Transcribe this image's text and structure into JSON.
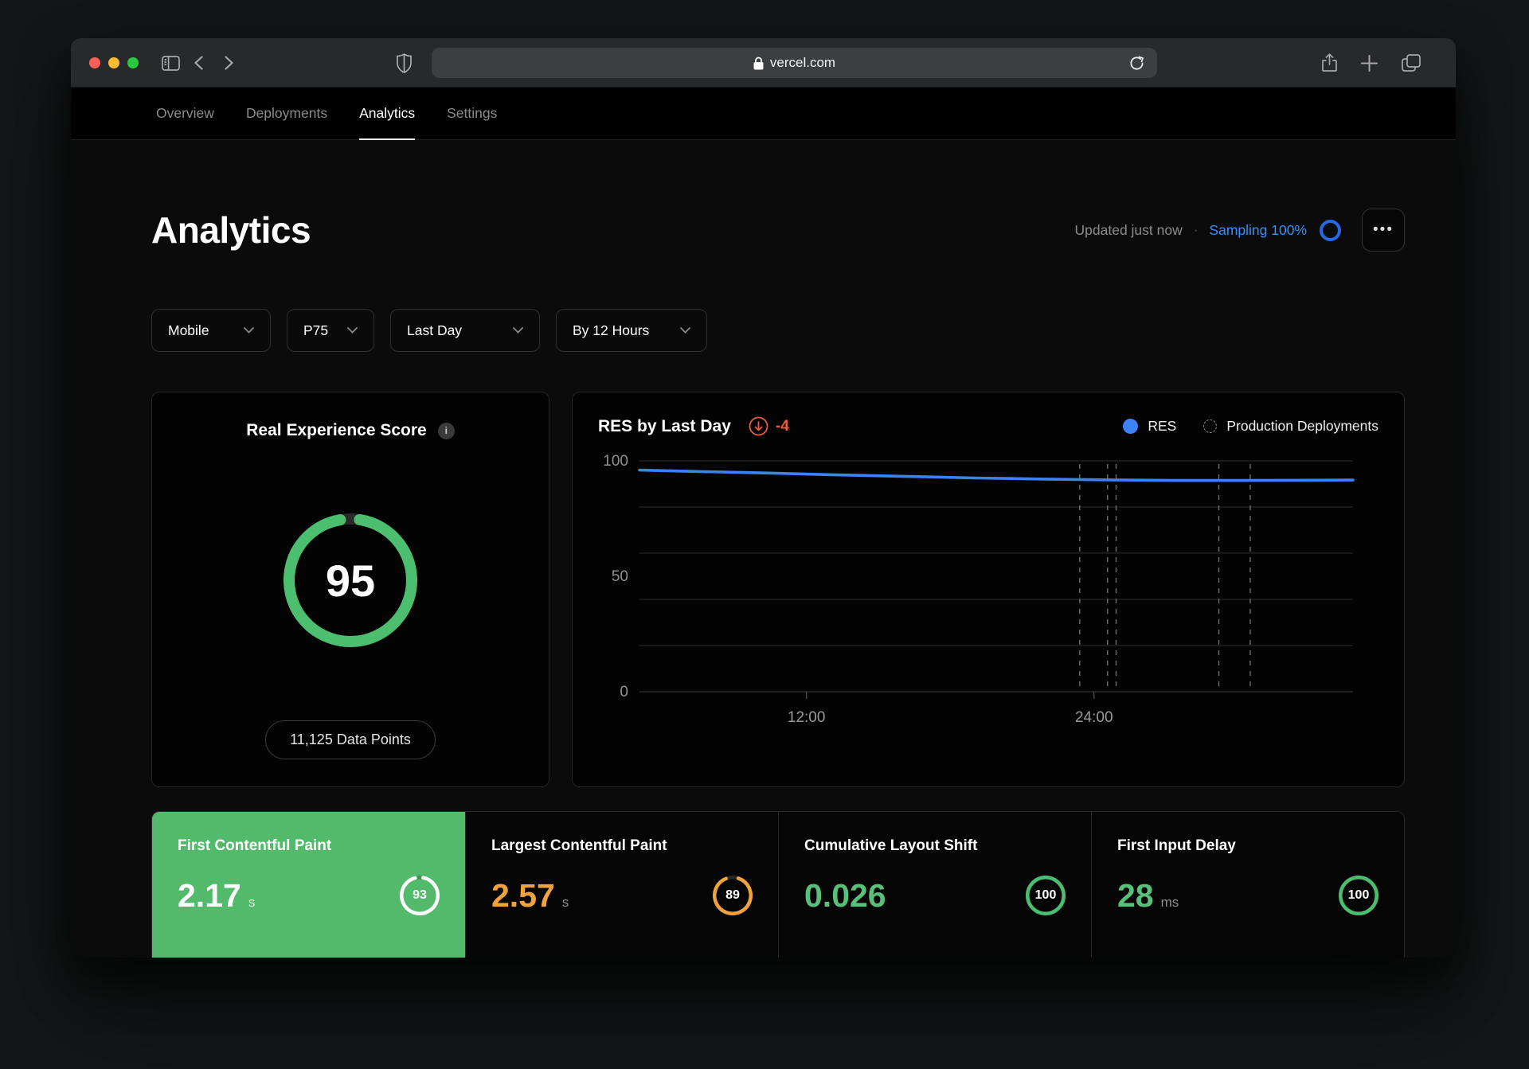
{
  "browser": {
    "url": "vercel.com",
    "traffic_lights": {
      "close": "#ff5f57",
      "minimize": "#febc2e",
      "zoom": "#28c840"
    }
  },
  "nav": {
    "tabs": [
      {
        "label": "Overview",
        "active": false
      },
      {
        "label": "Deployments",
        "active": false
      },
      {
        "label": "Analytics",
        "active": true
      },
      {
        "label": "Settings",
        "active": false
      }
    ]
  },
  "page": {
    "title": "Analytics",
    "updated": "Updated just now",
    "separator": "·",
    "sampling": "Sampling 100%"
  },
  "filters": [
    {
      "label": "Mobile"
    },
    {
      "label": "P75"
    },
    {
      "label": "Last Day"
    },
    {
      "label": "By 12 Hours"
    }
  ],
  "score_card": {
    "title": "Real Experience Score",
    "info_icon": "i",
    "score": 95,
    "max": 100,
    "ring_color": "#4cbe70",
    "data_points": "11,125 Data Points"
  },
  "chart_card": {
    "title": "RES by Last Day",
    "delta": "-4",
    "delta_color": "#ed5a41",
    "legend": [
      {
        "label": "RES",
        "marker": "dot",
        "color": "#3b82f6"
      },
      {
        "label": "Production Deployments",
        "marker": "dashed-circle"
      }
    ]
  },
  "chart_data": {
    "type": "line",
    "title": "RES by Last Day",
    "grid": "horizontal",
    "legend_position": "top-right",
    "y_axis": {
      "min": 0,
      "max": 100,
      "tick_labels": [
        100,
        50,
        0
      ],
      "gridline_step": 20
    },
    "x_ticks": [
      {
        "label": "12:00",
        "pos": 0.234
      },
      {
        "label": "24:00",
        "pos": 0.637
      }
    ],
    "series": [
      {
        "name": "RES",
        "color": "#3b82f6",
        "points": [
          [
            0,
            96
          ],
          [
            0.08,
            95.4
          ],
          [
            0.17,
            94.8
          ],
          [
            0.27,
            94.0
          ],
          [
            0.37,
            93.3
          ],
          [
            0.47,
            92.6
          ],
          [
            0.57,
            92.1
          ],
          [
            0.65,
            91.8
          ],
          [
            0.75,
            91.5
          ],
          [
            0.85,
            91.5
          ],
          [
            1,
            91.7
          ]
        ]
      }
    ],
    "deployment_markers": {
      "name": "Production Deployments",
      "positions": [
        0.617,
        0.656,
        0.668,
        0.812,
        0.856
      ]
    }
  },
  "metrics": [
    {
      "title": "First Contentful Paint",
      "value": "2.17",
      "unit": "s",
      "score": 93,
      "selected": true,
      "bg": "#53ba6b",
      "value_color": "#ffffff",
      "unit_color": "rgba(255,255,255,0.82)",
      "ring_color": "#ffffff",
      "track_color": "rgba(0,0,0,0.22)"
    },
    {
      "title": "Largest Contentful Paint",
      "value": "2.57",
      "unit": "s",
      "score": 89,
      "selected": false,
      "bg": "",
      "value_color": "#f0a33c",
      "unit_color": "#8f8f8f",
      "ring_color": "#f0a33c",
      "track_color": "#262626"
    },
    {
      "title": "Cumulative Layout Shift",
      "value": "0.026",
      "unit": "",
      "score": 100,
      "selected": false,
      "bg": "",
      "value_color": "#58c07b",
      "unit_color": "#8f8f8f",
      "ring_color": "#4cbe70",
      "track_color": "#262626"
    },
    {
      "title": "First Input Delay",
      "value": "28",
      "unit": "ms",
      "score": 100,
      "selected": false,
      "bg": "",
      "value_color": "#58c07b",
      "unit_color": "#8f8f8f",
      "ring_color": "#4cbe70",
      "track_color": "#262626"
    }
  ]
}
